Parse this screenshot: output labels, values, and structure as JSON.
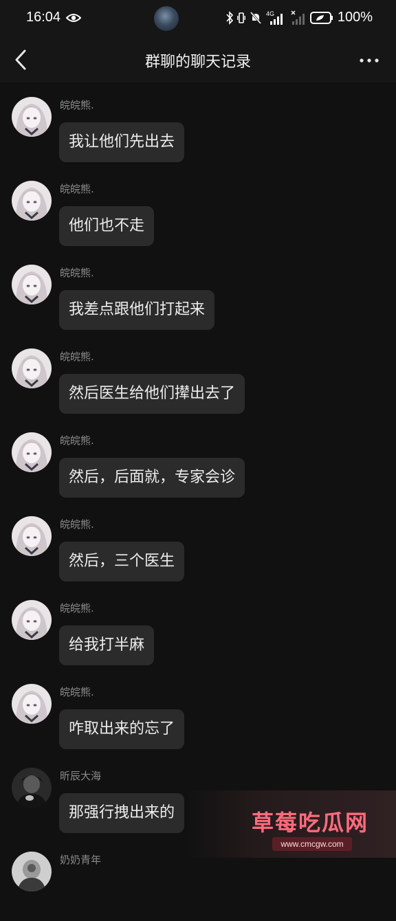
{
  "status_bar": {
    "time": "16:04",
    "battery": "100%",
    "network": "4G"
  },
  "nav": {
    "title": "群聊的聊天记录"
  },
  "messages": [
    {
      "sender": "皖皖熊.",
      "text": "我让他们先出去"
    },
    {
      "sender": "皖皖熊.",
      "text": "他们也不走"
    },
    {
      "sender": "皖皖熊.",
      "text": "我差点跟他们打起来"
    },
    {
      "sender": "皖皖熊.",
      "text": "然后医生给他们撵出去了"
    },
    {
      "sender": "皖皖熊.",
      "text": "然后，后面就，专家会诊"
    },
    {
      "sender": "皖皖熊.",
      "text": "然后，三个医生"
    },
    {
      "sender": "皖皖熊.",
      "text": "给我打半麻"
    },
    {
      "sender": "皖皖熊.",
      "text": "咋取出来的忘了"
    },
    {
      "sender": "昕辰大海",
      "text": "那强行拽出来的"
    },
    {
      "sender": "奶奶青年",
      "text": ""
    }
  ],
  "watermark": {
    "title": "草莓吃瓜网",
    "url": "www.cmcgw.com"
  },
  "colors": {
    "background": "#111111",
    "bubble": "#2b2b2b",
    "sender": "#8a8a8a",
    "watermark_accent": "#ff6b7d"
  }
}
